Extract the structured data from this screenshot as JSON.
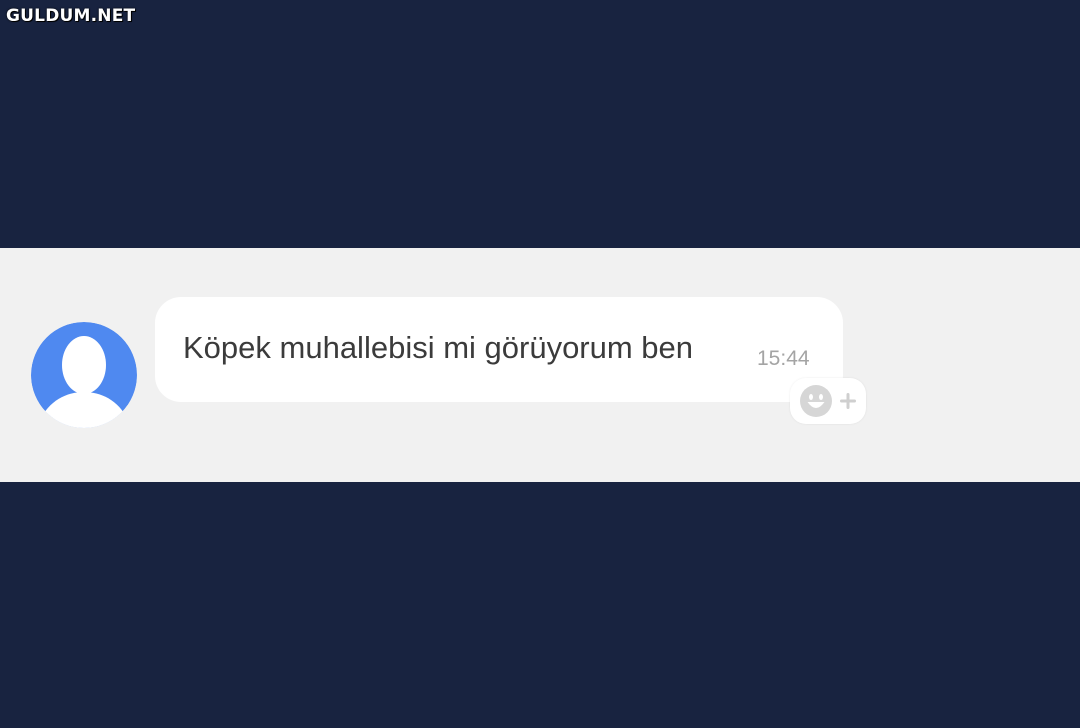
{
  "watermark": {
    "text": "GULDUM.NET"
  },
  "chat": {
    "message": {
      "text": "Köpek muhallebisi mi görüyorum ben",
      "time": "15:44"
    },
    "avatar": {
      "icon": "default-user-avatar-icon",
      "color": "#4f89f0"
    },
    "reaction": {
      "emoji_icon": "smiley-face-icon",
      "plus_icon": "plus-icon"
    }
  },
  "colors": {
    "background": "#182340",
    "chat_background": "#f1f1f1",
    "bubble": "#ffffff",
    "message_text": "#3b3b3b",
    "timestamp": "#a4a4a4"
  }
}
